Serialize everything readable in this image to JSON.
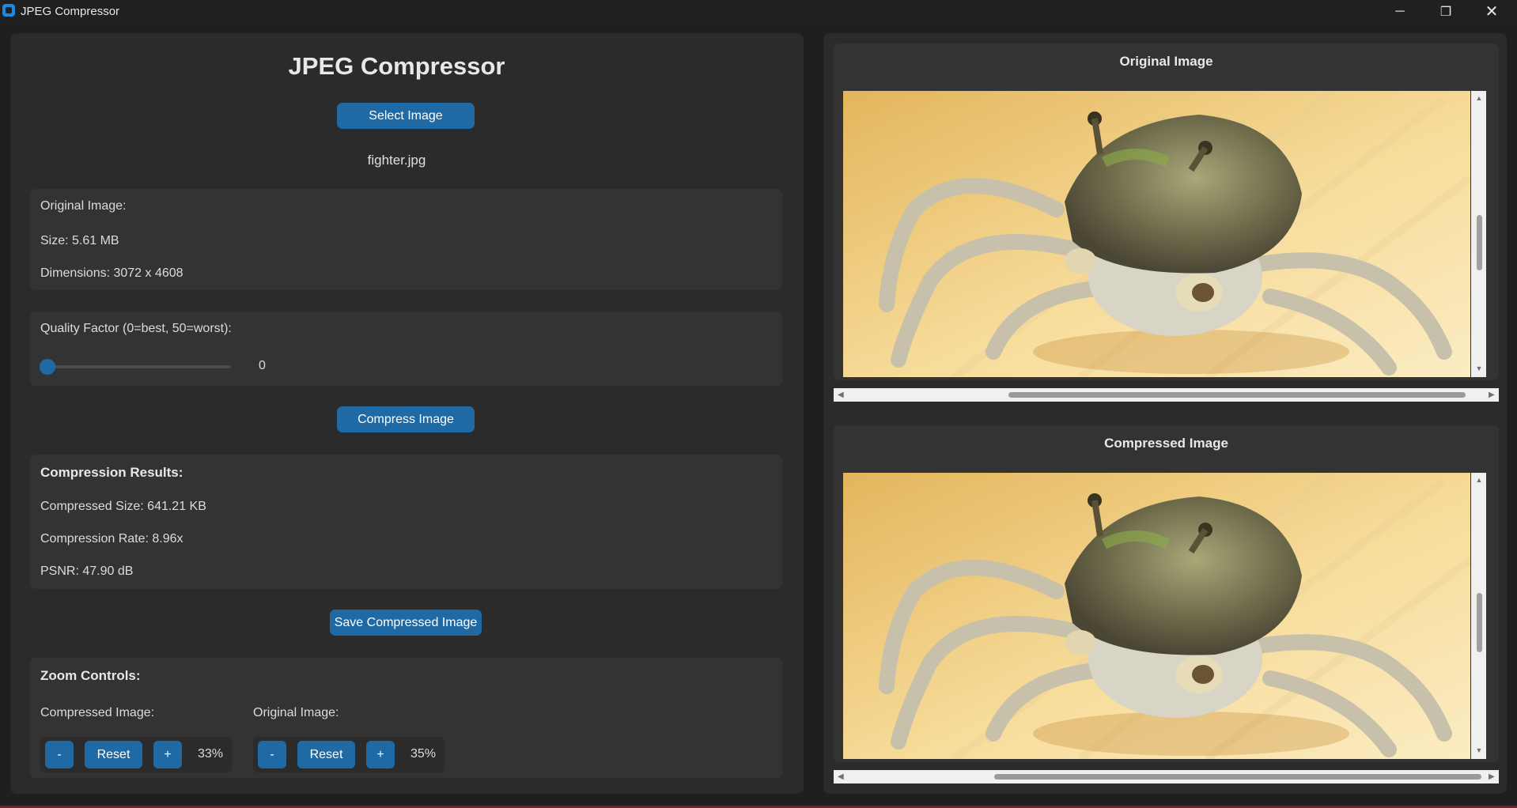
{
  "window": {
    "title": "JPEG Compressor",
    "controls": {
      "minimize": "─",
      "maximize": "❐",
      "close": "✕"
    }
  },
  "left": {
    "heading": "JPEG Compressor",
    "select_button": "Select Image",
    "file_name": "fighter.jpg",
    "original_info": {
      "title": "Original Image:",
      "size": "Size: 5.61 MB",
      "dimensions": "Dimensions: 3072 x 4608"
    },
    "quality": {
      "label": "Quality Factor (0=best, 50=worst):",
      "value": "0",
      "min": 0,
      "max": 50
    },
    "compress_button": "Compress Image",
    "results": {
      "title": "Compression Results:",
      "compressed_size": "Compressed Size: 641.21 KB",
      "rate": "Compression Rate: 8.96x",
      "psnr": "PSNR: 47.90 dB"
    },
    "save_button": "Save Compressed Image",
    "zoom": {
      "title": "Zoom Controls:",
      "compressed": {
        "label": "Compressed Image:",
        "minus": "-",
        "reset": "Reset",
        "plus": "+",
        "level": "33%"
      },
      "original": {
        "label": "Original Image:",
        "minus": "-",
        "reset": "Reset",
        "plus": "+",
        "level": "35%"
      }
    }
  },
  "right": {
    "original_title": "Original Image",
    "compressed_title": "Compressed Image"
  },
  "colors": {
    "accent": "#1f6aa5",
    "window_bg": "#1f1f1f",
    "panel_bg": "#2b2b2b",
    "card_bg": "#333333"
  }
}
